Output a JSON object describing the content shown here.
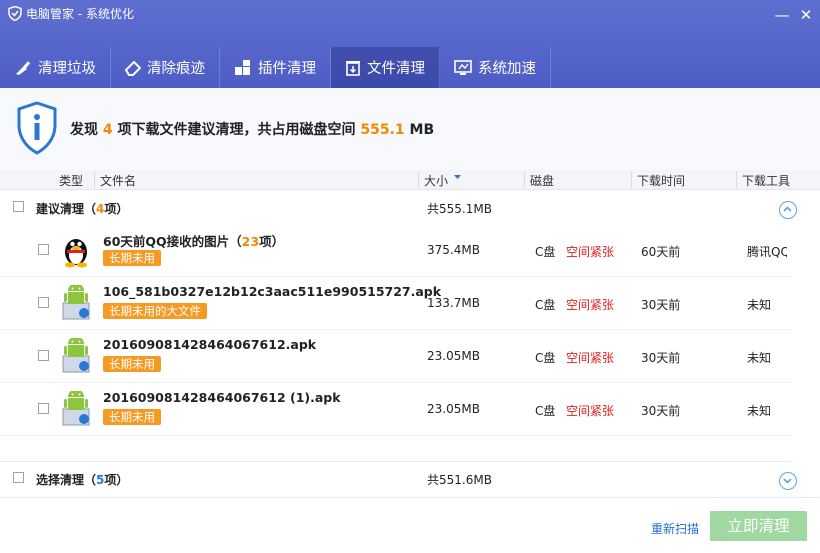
{
  "window": {
    "title": "电脑管家 - 系统优化",
    "minimize": "—",
    "close": "✕"
  },
  "tabs": [
    {
      "label": "清理垃圾",
      "icon": "broom-icon"
    },
    {
      "label": "清除痕迹",
      "icon": "eraser-icon"
    },
    {
      "label": "插件清理",
      "icon": "puzzle-icon"
    },
    {
      "label": "文件清理",
      "icon": "trash-file-icon",
      "active": true
    },
    {
      "label": "系统加速",
      "icon": "monitor-icon"
    }
  ],
  "summary": {
    "prefix": "发现",
    "count": "4",
    "middle": "项下载文件建议清理，共占用磁盘空间",
    "size": "555.1",
    "unit": "MB"
  },
  "columns": {
    "type": "类型",
    "name": "文件名",
    "size": "大小",
    "disk": "磁盘",
    "time": "下载时间",
    "tool": "下载工具"
  },
  "groups": {
    "suggested": {
      "label": "建议清理",
      "open": "（",
      "count": "4",
      "close": "项）",
      "total": "共555.1MB"
    },
    "optional": {
      "label": "选择清理",
      "open": "（",
      "count": "5",
      "close": "项）",
      "total": "共551.6MB"
    }
  },
  "rows": [
    {
      "name": "60天前QQ接收的图片",
      "name_count_open": "（",
      "name_count": "23",
      "name_count_close": "项）",
      "tag": "长期未用",
      "size": "375.4MB",
      "disk": "C盘",
      "status": "空间紧张",
      "time": "60天前",
      "tool": "腾讯QQ",
      "icon": "qq-penguin-icon"
    },
    {
      "name": "106_581b0327e12b12c3aac511e990515727.apk",
      "tag": "长期未用的大文件",
      "size": "133.7MB",
      "disk": "C盘",
      "status": "空间紧张",
      "time": "30天前",
      "tool": "未知",
      "icon": "android-apk-icon"
    },
    {
      "name": "20160908142846406761​2.apk",
      "tag": "长期未用",
      "size": "23.05MB",
      "disk": "C盘",
      "status": "空间紧张",
      "time": "30天前",
      "tool": "未知",
      "icon": "android-apk-icon"
    },
    {
      "name": "201609081428464067612 (1).apk",
      "tag": "长期未用",
      "size": "23.05MB",
      "disk": "C盘",
      "status": "空间紧张",
      "time": "30天前",
      "tool": "未知",
      "icon": "android-apk-icon"
    }
  ],
  "footer": {
    "rescan": "重新扫描",
    "clean_now": "立即清理"
  },
  "colors": {
    "titlebar": "#5565c8",
    "accent_orange": "#f08a00",
    "tag_orange": "#f59a23",
    "warn_red": "#e02020",
    "button_green": "#9fd8a0",
    "link_blue": "#1f6fd6"
  }
}
